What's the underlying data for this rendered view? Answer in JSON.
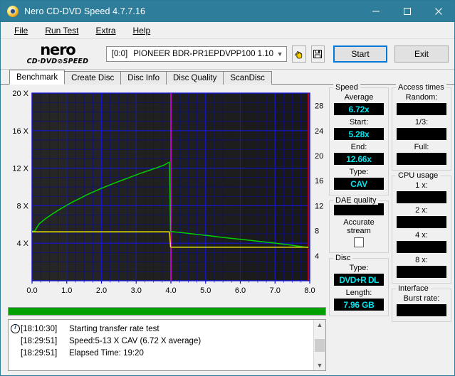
{
  "window": {
    "title": "Nero CD-DVD Speed 4.7.7.16",
    "icon": "nero-disc-icon",
    "minimize": "minimize-icon",
    "maximize": "maximize-icon",
    "close": "close-icon"
  },
  "menu": [
    {
      "label": "File",
      "accel": "F"
    },
    {
      "label": "Run Test",
      "accel": "R"
    },
    {
      "label": "Extra",
      "accel": "E"
    },
    {
      "label": "Help",
      "accel": "H"
    }
  ],
  "logo": {
    "main": "nero",
    "sub": "CD·DVD⊘SPEED"
  },
  "toolbar": {
    "drive_id": "[0:0]",
    "drive_name": "PIONEER BDR-PR1EPDVPP100 1.10",
    "dropdown_arrow": "chevron-down-icon",
    "scan_button_icon": "hand-pointer-icon",
    "save_button_icon": "floppy-save-icon",
    "start_label": "Start",
    "start_accel": "S",
    "exit_label": "Exit",
    "exit_accel": "x"
  },
  "tabs": [
    {
      "label": "Benchmark",
      "active": true
    },
    {
      "label": "Create Disc",
      "active": false
    },
    {
      "label": "Disc Info",
      "active": false
    },
    {
      "label": "Disc Quality",
      "active": false
    },
    {
      "label": "ScanDisc",
      "active": false
    }
  ],
  "chart_data": {
    "type": "line",
    "title": "",
    "xlabel": "",
    "ylabel": "",
    "xlim": [
      0.0,
      8.0
    ],
    "xticks": [
      "0.0",
      "1.0",
      "2.0",
      "3.0",
      "4.0",
      "5.0",
      "6.0",
      "7.0",
      "8.0"
    ],
    "ylim_left": [
      0,
      20
    ],
    "yticks_left": [
      "20 X",
      "16 X",
      "12 X",
      "8 X",
      "4 X"
    ],
    "ylim_right": [
      0,
      30
    ],
    "yticks_right": [
      "28",
      "24",
      "20",
      "16",
      "12",
      "8",
      "4"
    ],
    "grid": true,
    "plot_bg": "#2b2b2b",
    "grid_color": "#1616d2",
    "legend": [],
    "annotations": [
      {
        "name": "layer-break-marker",
        "x": 4.0,
        "color": "#cc00cc"
      },
      {
        "name": "end-marker",
        "x": 7.96,
        "color": "#d00000"
      }
    ],
    "series": [
      {
        "name": "Read speed",
        "color": "#00d000",
        "axis": "left",
        "points": [
          [
            0.0,
            5.28
          ],
          [
            0.08,
            5.3
          ],
          [
            0.2,
            6.05
          ],
          [
            0.4,
            6.65
          ],
          [
            0.6,
            7.15
          ],
          [
            0.8,
            7.62
          ],
          [
            1.0,
            8.05
          ],
          [
            1.2,
            8.45
          ],
          [
            1.4,
            8.82
          ],
          [
            1.6,
            9.2
          ],
          [
            1.8,
            9.52
          ],
          [
            2.0,
            9.85
          ],
          [
            2.2,
            10.15
          ],
          [
            2.4,
            10.45
          ],
          [
            2.6,
            10.72
          ],
          [
            2.8,
            11.0
          ],
          [
            3.0,
            11.28
          ],
          [
            3.2,
            11.55
          ],
          [
            3.4,
            11.8
          ],
          [
            3.6,
            12.05
          ],
          [
            3.8,
            12.32
          ],
          [
            3.96,
            12.66
          ],
          [
            3.99,
            5.25
          ],
          [
            4.2,
            5.18
          ],
          [
            4.5,
            5.05
          ],
          [
            4.8,
            4.92
          ],
          [
            5.1,
            4.8
          ],
          [
            5.4,
            4.66
          ],
          [
            5.7,
            4.54
          ],
          [
            6.0,
            4.42
          ],
          [
            6.3,
            4.3
          ],
          [
            6.6,
            4.18
          ],
          [
            6.9,
            4.05
          ],
          [
            7.2,
            3.92
          ],
          [
            7.5,
            3.78
          ],
          [
            7.8,
            3.62
          ],
          [
            7.96,
            3.55
          ]
        ]
      },
      {
        "name": "Transfer rate (secondary)",
        "color": "#e8e800",
        "axis": "left",
        "points": [
          [
            0.0,
            5.22
          ],
          [
            1.0,
            5.22
          ],
          [
            2.0,
            5.22
          ],
          [
            3.0,
            5.22
          ],
          [
            3.96,
            5.22
          ],
          [
            3.99,
            3.58
          ],
          [
            5.0,
            3.58
          ],
          [
            6.0,
            3.58
          ],
          [
            7.0,
            3.58
          ],
          [
            7.96,
            3.58
          ]
        ]
      }
    ]
  },
  "progress": {
    "percent": 100,
    "color": "#00a000"
  },
  "log": {
    "entries": [
      {
        "icon": "info-icon",
        "time": "[18:10:30]",
        "message": "Starting transfer rate test"
      },
      {
        "icon": "",
        "time": "[18:29:51]",
        "message": "Speed:5-13 X CAV (6.72 X average)"
      },
      {
        "icon": "",
        "time": "[18:29:51]",
        "message": "Elapsed Time: 19:20"
      }
    ],
    "scroll_up": "chevron-up-icon",
    "scroll_down": "chevron-down-icon"
  },
  "panels": {
    "speed": {
      "title": "Speed",
      "fields": [
        {
          "label": "Average",
          "value": "6.72x"
        },
        {
          "label": "Start:",
          "value": "5.28x"
        },
        {
          "label": "End:",
          "value": "12.66x"
        },
        {
          "label": "Type:",
          "value": "CAV"
        }
      ]
    },
    "dae_quality": {
      "title": "DAE quality",
      "value": "",
      "accurate_stream_label": "Accurate stream",
      "accurate_stream_checked": false
    },
    "disc": {
      "title": "Disc",
      "fields": [
        {
          "label": "Type:",
          "value": "DVD+R DL"
        },
        {
          "label": "Length:",
          "value": "7.96 GB"
        }
      ]
    },
    "access_times": {
      "title": "Access times",
      "fields": [
        {
          "label": "Random:",
          "value": ""
        },
        {
          "label": "1/3:",
          "value": ""
        },
        {
          "label": "Full:",
          "value": ""
        }
      ]
    },
    "cpu_usage": {
      "title": "CPU usage",
      "fields": [
        {
          "label": "1 x:",
          "value": ""
        },
        {
          "label": "2 x:",
          "value": ""
        },
        {
          "label": "4 x:",
          "value": ""
        },
        {
          "label": "8 x:",
          "value": ""
        }
      ]
    },
    "interface": {
      "title": "Interface",
      "fields": [
        {
          "label": "Burst rate:",
          "value": ""
        }
      ]
    }
  },
  "colors": {
    "titlebar": "#2e7d9a",
    "accent_cyan": "#00e5ee",
    "speed_green": "#00d000",
    "speed_yellow": "#e8e800",
    "progress_green": "#00a000"
  }
}
